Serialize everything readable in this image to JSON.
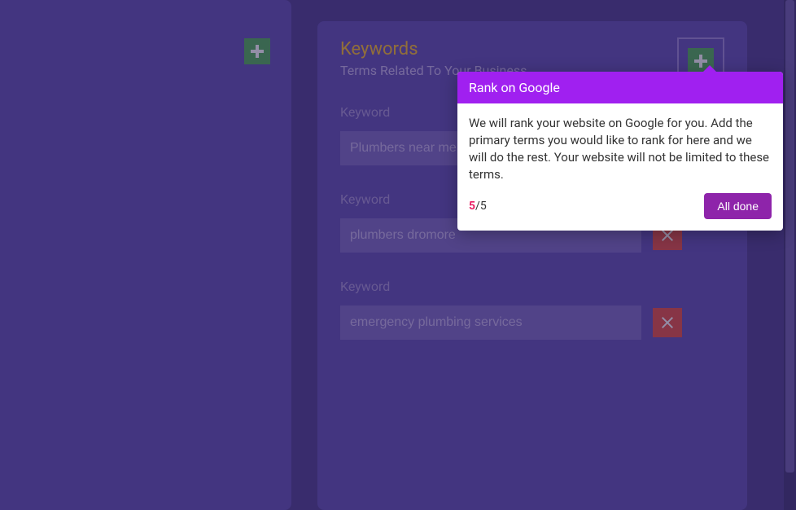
{
  "section": {
    "title": "Keywords",
    "subtitle": "Terms Related To Your Business"
  },
  "keywords": [
    {
      "label": "Keyword",
      "placeholder": "Plumbers near me",
      "value": "",
      "deletable": true
    },
    {
      "label": "Keyword",
      "placeholder": "",
      "value": "plumbers dromore",
      "deletable": true
    },
    {
      "label": "Keyword",
      "placeholder": "",
      "value": "emergency plumbing services",
      "deletable": true
    }
  ],
  "tooltip": {
    "title": "Rank on Google",
    "body": "We will rank your website on Google for you. Add the primary terms you would like to rank for here and we will do the rest. Your website will not be limited to these terms.",
    "progress_current": "5",
    "progress_separator": "/5",
    "action_label": "All done"
  }
}
